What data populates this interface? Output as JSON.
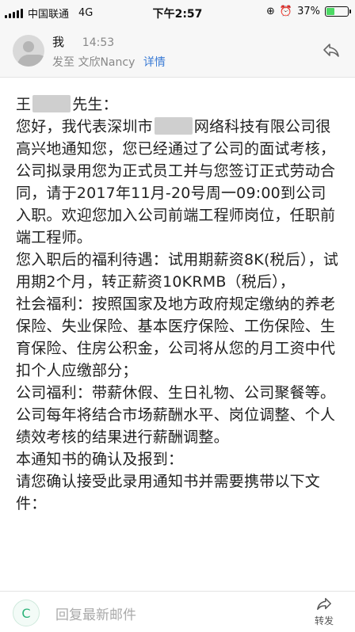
{
  "status_bar": {
    "carrier": "中国联通",
    "network": "4G",
    "time": "下午2:57",
    "battery_text": "37%",
    "battery_level": 0.37
  },
  "mail_header": {
    "sender": "我",
    "time": "14:53",
    "to_prefix": "发至",
    "recipient": "文欣Nancy",
    "detail_link": "详情"
  },
  "body": {
    "greeting_part1": "王",
    "greeting_part2": "先生：",
    "intro_part1": "您好，我代表深圳市",
    "intro_part2": "网络科技有限公司很高兴地通知您，您已经通过了公司的面试考核，公司拟录用您为正式员工并与您签订正式劳动合同，请于2017年11月-20号周一09:00到公司入职。欢迎您加入公司前端工程师岗位，任职前端工程师。",
    "benefits": "您入职后的福利待遇：试用期薪资8K(税后），试用期2个月，转正薪资10KRMB（税后），",
    "social_welfare": "社会福利：按照国家及地方政府规定缴纳的养老保险、失业保险、基本医疗保险、工伤保险、生育保险、住房公积金，公司将从您的月工资中代扣个人应缴部分；",
    "company_welfare": "公司福利：带薪休假、生日礼物、公司聚餐等。",
    "salary_review": "公司每年将结合市场薪酬水平、岗位调整、个人绩效考核的结果进行薪酬调整。",
    "confirm_title": "本通知书的确认及报到：",
    "confirm_text": "请您确认接受此录用通知书并需要携带以下文件："
  },
  "bottom_bar": {
    "badge": "C",
    "reply_placeholder": "回复最新邮件",
    "forward_label": "转发"
  }
}
